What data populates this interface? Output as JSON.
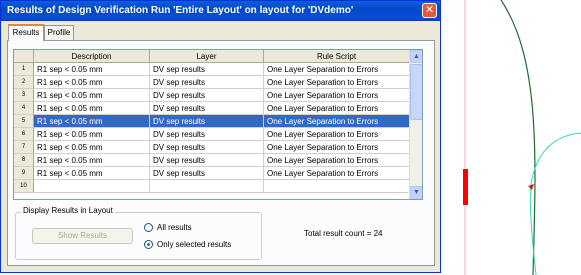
{
  "window": {
    "title": "Results of Design Verification Run 'Entire Layout' on layout for  'DVdemo'",
    "close_glyph": "✕"
  },
  "tabs": [
    {
      "label": "Results",
      "active": true
    },
    {
      "label": "Profile",
      "active": false
    }
  ],
  "grid": {
    "columns": [
      "Description",
      "Layer",
      "Rule Script"
    ],
    "rows": [
      {
        "num": "1",
        "description": "R1 sep < 0.05 mm",
        "layer": "DV sep results",
        "rule": "One Layer Separation to Errors",
        "selected": false
      },
      {
        "num": "2",
        "description": "R1 sep < 0.05 mm",
        "layer": "DV sep results",
        "rule": "One Layer Separation to Errors",
        "selected": false
      },
      {
        "num": "3",
        "description": "R1 sep < 0.05 mm",
        "layer": "DV sep results",
        "rule": "One Layer Separation to Errors",
        "selected": false
      },
      {
        "num": "4",
        "description": "R1 sep < 0.05 mm",
        "layer": "DV sep results",
        "rule": "One Layer Separation to Errors",
        "selected": false
      },
      {
        "num": "5",
        "description": "R1 sep < 0.05 mm",
        "layer": "DV sep results",
        "rule": "One Layer Separation to Errors",
        "selected": true
      },
      {
        "num": "6",
        "description": "R1 sep < 0.05 mm",
        "layer": "DV sep results",
        "rule": "One Layer Separation to Errors",
        "selected": false
      },
      {
        "num": "7",
        "description": "R1 sep < 0.05 mm",
        "layer": "DV sep results",
        "rule": "One Layer Separation to Errors",
        "selected": false
      },
      {
        "num": "8",
        "description": "R1 sep < 0.05 mm",
        "layer": "DV sep results",
        "rule": "One Layer Separation to Errors",
        "selected": false
      },
      {
        "num": "9",
        "description": "R1 sep < 0.05 mm",
        "layer": "DV sep results",
        "rule": "One Layer Separation to Errors",
        "selected": false
      },
      {
        "num": "10",
        "description": "",
        "layer": "",
        "rule": "",
        "selected": false
      }
    ]
  },
  "display_group": {
    "label": "Display Results in Layout",
    "show_button": "Show Results",
    "radio_all": "All results",
    "radio_selected": "Only selected results",
    "selected_option": "selected"
  },
  "total_text": "Total result count = 24",
  "colors": {
    "selection": "#316ac5",
    "marker_red": "#ff0000",
    "curve_dark_green": "#1f6b2f",
    "curve_cyan": "#3ad8b0"
  }
}
